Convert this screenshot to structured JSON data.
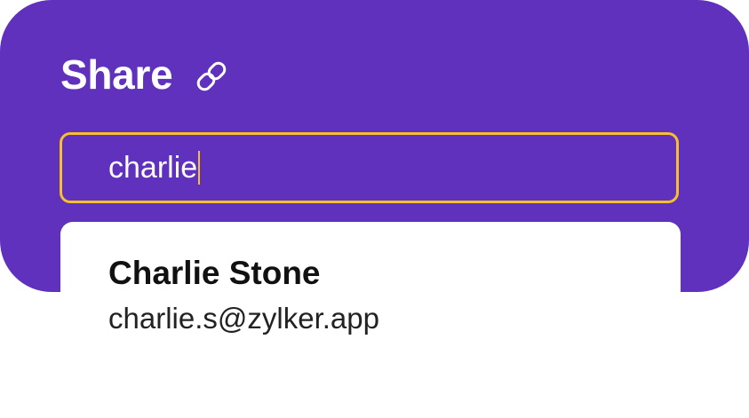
{
  "share_panel": {
    "title": "Share",
    "title_icon": "link-icon",
    "background_color": "#5f31bd"
  },
  "search": {
    "value": "charlie",
    "focus_border_color": "#f7bf2c"
  },
  "suggestions": [
    {
      "name": "Charlie Stone",
      "email": "charlie.s@zylker.app"
    }
  ]
}
